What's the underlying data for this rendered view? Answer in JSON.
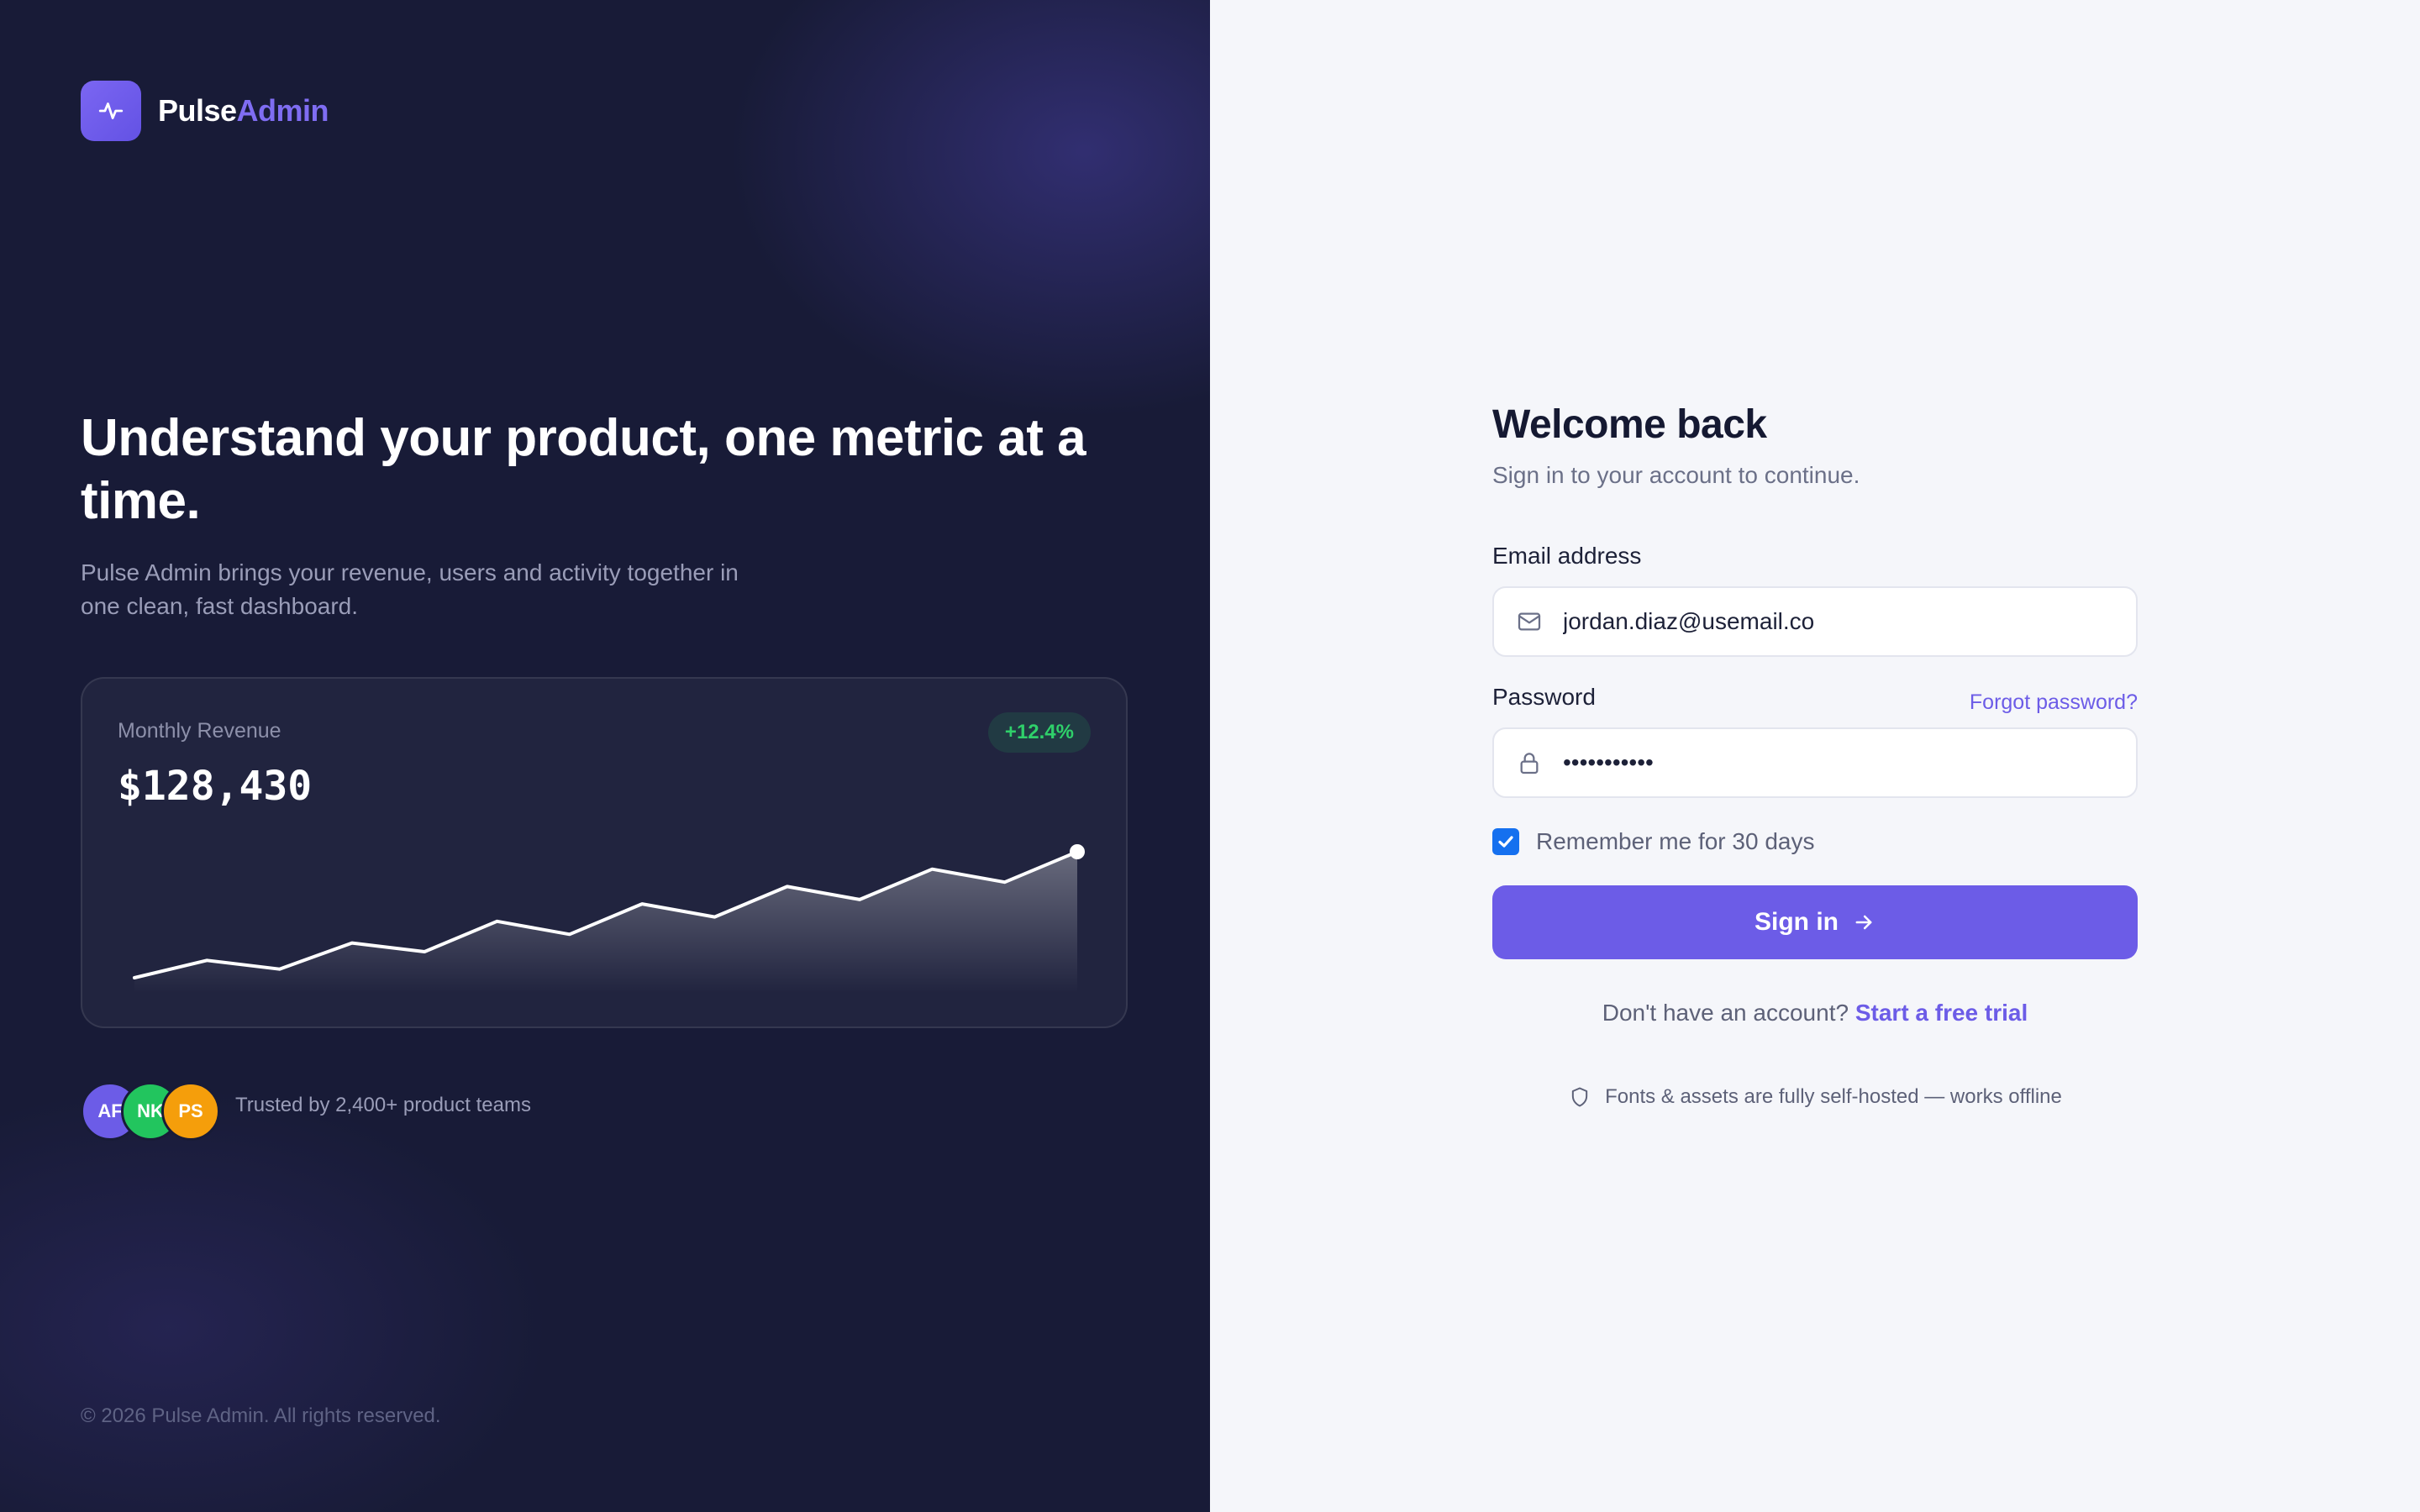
{
  "brand": {
    "name_part1": "Pulse",
    "name_part2": "Admin",
    "logo_icon": "pulse-icon",
    "accent": "#6c5ce7"
  },
  "hero": {
    "headline": "Understand your product, one metric at a time.",
    "subheadline": "Pulse Admin brings your revenue, users and activity together in one clean, fast dashboard."
  },
  "metric_card": {
    "label": "Monthly Revenue",
    "value": "$128,430",
    "change": "+12.4%",
    "change_color": "#22c55e"
  },
  "chart_data": {
    "type": "area",
    "values": [
      12,
      20,
      16,
      28,
      24,
      38,
      32,
      46,
      40,
      54,
      48,
      62,
      56,
      70
    ]
  },
  "social_proof": {
    "avatars": [
      {
        "initials": "AF",
        "color": "#6c5ce7"
      },
      {
        "initials": "NK",
        "color": "#22c55e"
      },
      {
        "initials": "PS",
        "color": "#f59e0b"
      }
    ],
    "text": "Trusted by 2,400+ product teams"
  },
  "footer": {
    "copyright": "© 2026 Pulse Admin. All rights reserved."
  },
  "login": {
    "title": "Welcome back",
    "subtitle": "Sign in to your account to continue.",
    "email_label": "Email address",
    "email_value": "jordan.diaz@usemail.co",
    "email_icon": "mail-icon",
    "password_label": "Password",
    "password_value": "•••••••••••",
    "password_icon": "lock-icon",
    "forgot_label": "Forgot password?",
    "remember_label": "Remember me for 30 days",
    "remember_checked": true,
    "submit_label": "Sign in",
    "signup_prompt": "Don't have an account?",
    "signup_link": "Start a free trial",
    "note_icon": "shield-icon",
    "note": "Fonts & assets are fully self-hosted — works offline"
  }
}
